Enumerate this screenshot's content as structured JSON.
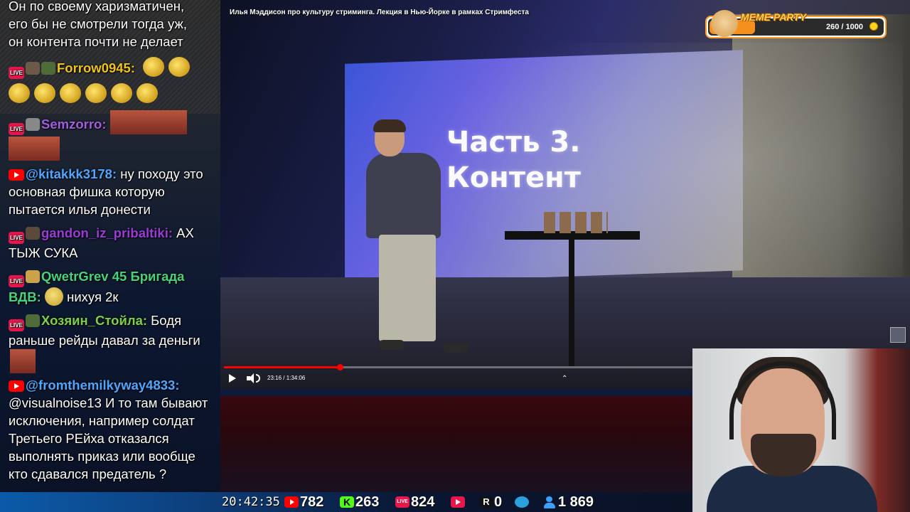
{
  "video": {
    "title": "Илья Мэддисон про культуру стриминга. Лекция в Нью-Йорке в рамках Стримфеста",
    "slide_lines": [
      "Часть 3.",
      "Контент"
    ],
    "time": "23:16 / 1:34:06",
    "progress_percent": 24.7,
    "chevron": "⌃"
  },
  "meme_party": {
    "title": "MEME PARTY",
    "score": "260 / 1000",
    "progress_fraction": 0.26
  },
  "chat": {
    "lines": [
      {
        "text": "Он по своему харизматичен,"
      },
      {
        "text": "его бы не смотрели тогда уж,"
      },
      {
        "text": "он контента почти не делает"
      }
    ],
    "messages": [
      {
        "platform": "live",
        "nick": "Forrow0945:",
        "nick_color": "#f0c419",
        "text": ""
      },
      {
        "platform": "live",
        "nick": "Semzorro:",
        "nick_color": "#a35ee0",
        "text": ""
      },
      {
        "platform": "youtube",
        "nick": "@kitakkk3178:",
        "nick_color": "#4fa6ff",
        "text": " ну походу это основная фишка которую пытается илья донести"
      },
      {
        "platform": "live",
        "nick": "gandon_iz_pribaltiki:",
        "nick_color": "#9b3bd6",
        "text": " АХ ТЫЖ СУКА"
      },
      {
        "platform": "live",
        "nick": "QwetrGrev 45 Бригада ВДВ:",
        "nick_color": "#46d37c",
        "text": " нихуя 2к"
      },
      {
        "platform": "live",
        "nick": "Хозяин_Стойла:",
        "nick_color": "#7cd14a",
        "text": " Бодя раньше рейды давал за деньги"
      },
      {
        "platform": "youtube",
        "nick": "@fromthemilkyway4833:",
        "nick_color": "#4fa6ff",
        "text": " @visualnoise13 И то там бывают исключения, например солдат Третьего РЕйха отказался выполнять приказ или вообще кто сдавался предатель ?"
      }
    ]
  },
  "status": {
    "clock": "20:42:35",
    "youtube_viewers": "782",
    "kick_viewers": "263",
    "vklive_viewers": "824",
    "rutube_viewers": "0",
    "total_viewers": "1 869",
    "kick_letter": "K",
    "rutube_letter": "R",
    "live_badge": "LIVE"
  },
  "colors": {
    "youtube_red": "#ff0000",
    "kick_green": "#53fc18",
    "vk_live_pink": "#e8174b",
    "telegram_blue": "#2aa1da"
  }
}
